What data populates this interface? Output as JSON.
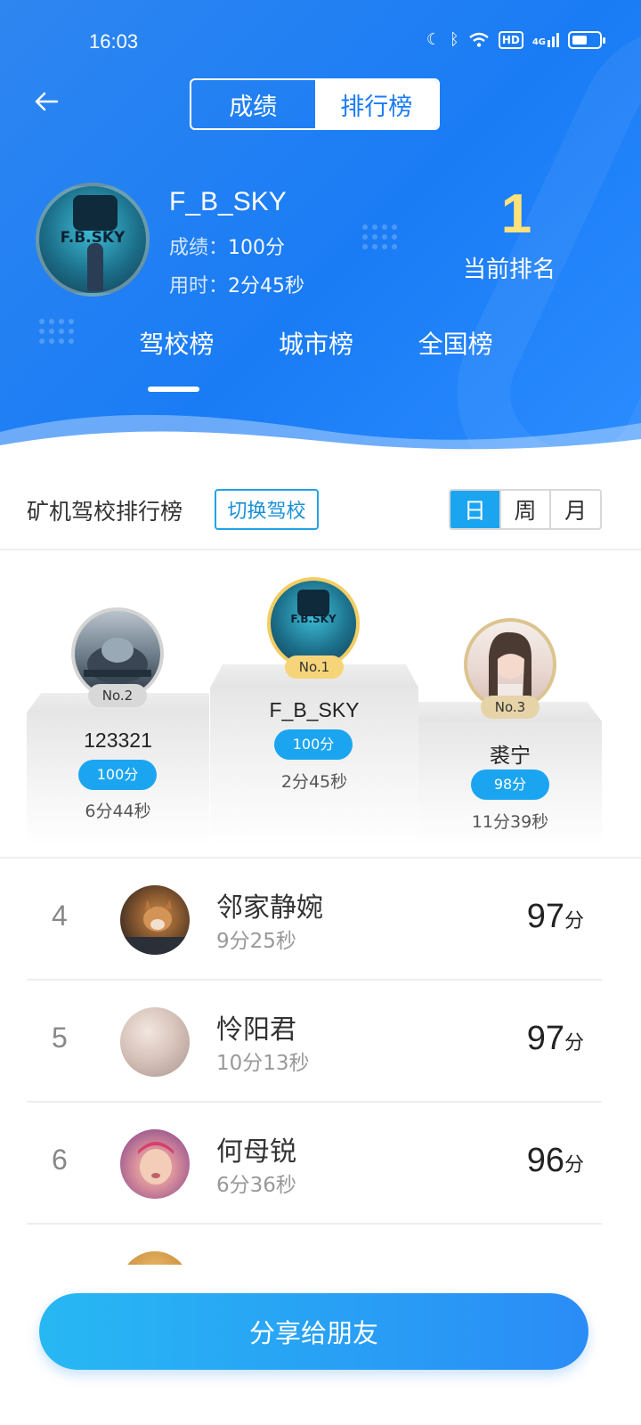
{
  "status_bar": {
    "time": "16:03",
    "hd": "HD",
    "net": "4G"
  },
  "header": {
    "segments": [
      {
        "label": "成绩",
        "active": false
      },
      {
        "label": "排行榜",
        "active": true
      }
    ],
    "user": {
      "name": "F_B_SKY",
      "score_key": "成绩：",
      "score_val": "100分",
      "time_key": "用时：",
      "time_val": "2分45秒",
      "avatar_logo": "F.B.SKY"
    },
    "rank": {
      "value": "1",
      "label": "当前排名"
    },
    "tabs": [
      {
        "label": "驾校榜",
        "active": true
      },
      {
        "label": "城市榜",
        "active": false
      },
      {
        "label": "全国榜",
        "active": false
      }
    ]
  },
  "section": {
    "title": "矿机驾校排行榜",
    "switch_label": "切换驾校",
    "periods": [
      {
        "label": "日",
        "active": true
      },
      {
        "label": "周",
        "active": false
      },
      {
        "label": "月",
        "active": false
      }
    ]
  },
  "podium": {
    "first": {
      "badge": "No.1",
      "name": "F_B_SKY",
      "score": "100分",
      "time": "2分45秒"
    },
    "second": {
      "badge": "No.2",
      "name": "123321",
      "score": "100分",
      "time": "6分44秒"
    },
    "third": {
      "badge": "No.3",
      "name": "裘宁",
      "score": "98分",
      "time": "11分39秒"
    }
  },
  "list": [
    {
      "rank": "4",
      "name": "邻家静婉",
      "time": "9分25秒",
      "score": "97",
      "unit": "分"
    },
    {
      "rank": "5",
      "name": "怜阳君",
      "time": "10分13秒",
      "score": "97",
      "unit": "分"
    },
    {
      "rank": "6",
      "name": "何母锐",
      "time": "6分36秒",
      "score": "96",
      "unit": "分"
    }
  ],
  "share_label": "分享给朋友"
}
